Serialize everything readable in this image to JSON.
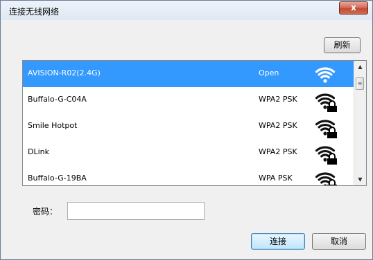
{
  "window": {
    "title": "连接无线网络",
    "close_label": "x"
  },
  "toolbar": {
    "refresh_label": "刷新"
  },
  "networks": [
    {
      "ssid": "AVISION-R02(2.4G)",
      "security": "Open",
      "selected": true,
      "locked": false
    },
    {
      "ssid": "Buffalo-G-C04A",
      "security": "WPA2 PSK",
      "selected": false,
      "locked": true
    },
    {
      "ssid": "Smile Hotpot",
      "security": "WPA2 PSK",
      "selected": false,
      "locked": true
    },
    {
      "ssid": "DLink",
      "security": "WPA2 PSK",
      "selected": false,
      "locked": true
    },
    {
      "ssid": "Buffalo-G-19BA",
      "security": "WPA PSK",
      "selected": false,
      "locked": true
    }
  ],
  "icons": {
    "signal": "wifi-signal-icon",
    "lock": "lock-icon"
  },
  "colors": {
    "selection": "#3399ff",
    "signal_selected": "#ffffff",
    "signal_normal": "#111111"
  },
  "password": {
    "label": "密码：",
    "value": "",
    "placeholder": ""
  },
  "actions": {
    "connect_label": "连接",
    "cancel_label": "取消"
  }
}
